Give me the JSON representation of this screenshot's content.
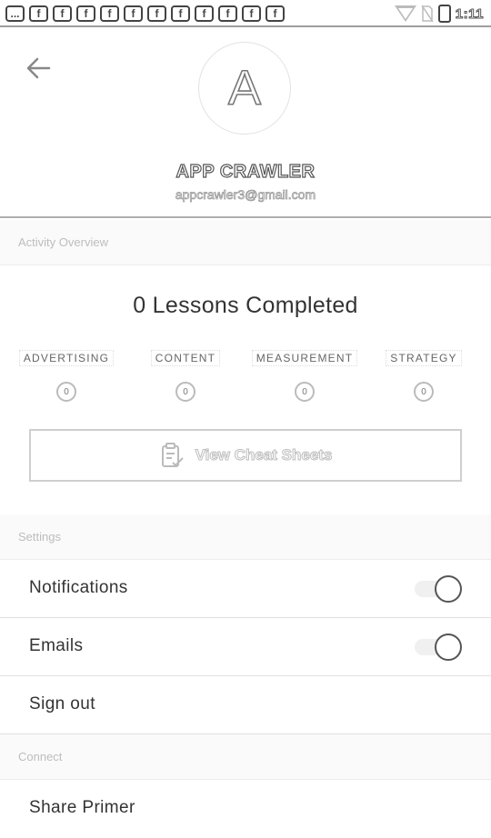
{
  "status_bar": {
    "notification_icons": [
      "...",
      "f",
      "f",
      "f",
      "f",
      "f",
      "f",
      "f",
      "f",
      "f",
      "f",
      "f"
    ],
    "time": "1:11"
  },
  "header": {
    "back_icon": "arrow-left-icon",
    "avatar_letter": "A",
    "user_name": "APP CRAWLER",
    "user_email": "appcrawler3@gmail.com"
  },
  "activity": {
    "section_title": "Activity Overview",
    "lessons_completed": "0 Lessons Completed",
    "categories": [
      {
        "label": "ADVERTISING",
        "count": "0"
      },
      {
        "label": "CONTENT",
        "count": "0"
      },
      {
        "label": "MEASUREMENT",
        "count": "0"
      },
      {
        "label": "STRATEGY",
        "count": "0"
      }
    ],
    "cheat_sheets_label": "View Cheat Sheets",
    "cheat_sheets_icon": "clipboard-check-icon"
  },
  "settings": {
    "section_title": "Settings",
    "notifications_label": "Notifications",
    "notifications_on": true,
    "emails_label": "Emails",
    "emails_on": true,
    "sign_out_label": "Sign out"
  },
  "connect": {
    "section_title": "Connect",
    "share_label": "Share Primer"
  }
}
